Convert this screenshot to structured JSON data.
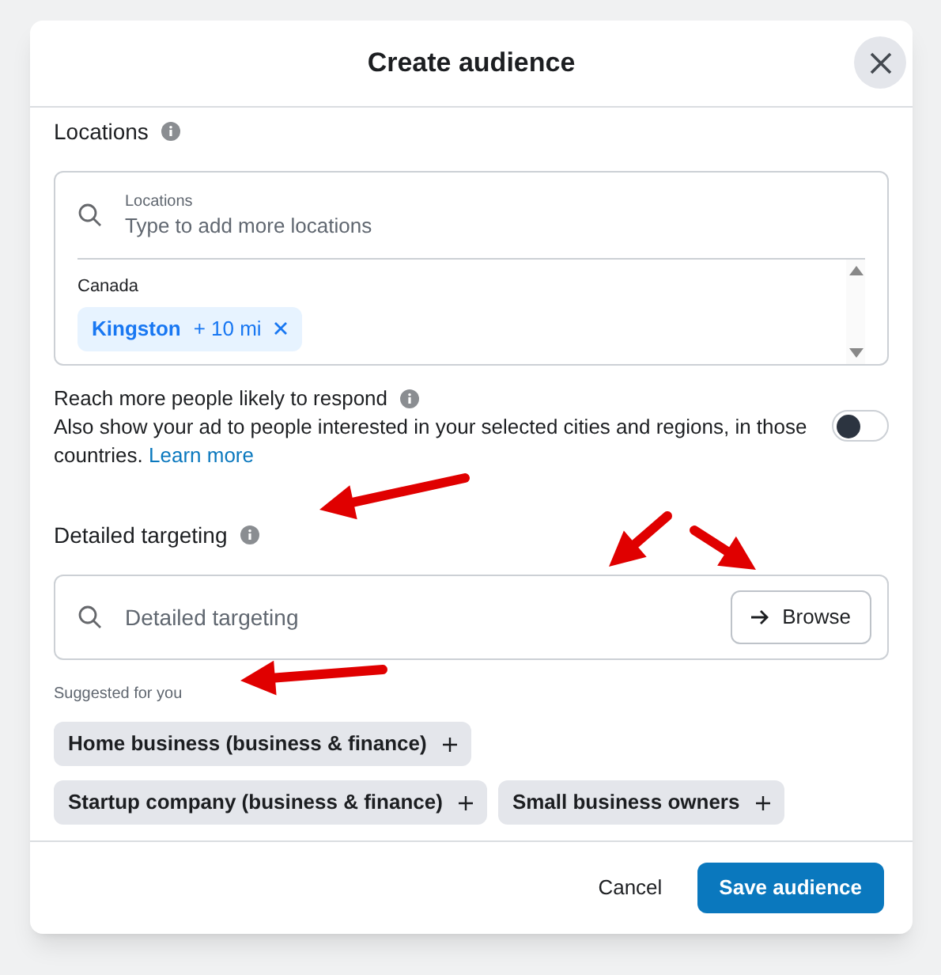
{
  "dialog": {
    "title": "Create audience"
  },
  "locations": {
    "label": "Locations",
    "field_label": "Locations",
    "placeholder": "Type to add more locations",
    "country": "Canada",
    "chips": [
      {
        "name": "Kingston",
        "radius": "+ 10 mi"
      }
    ]
  },
  "reach_more": {
    "title": "Reach more people likely to respond",
    "description": "Also show your ad to people interested in your selected cities and regions, in those countries.",
    "link": "Learn more",
    "on": false
  },
  "detailed_targeting": {
    "label": "Detailed targeting",
    "placeholder": "Detailed targeting",
    "browse": "Browse"
  },
  "suggestions": {
    "label": "Suggested for you",
    "rows": [
      [
        "Home business (business & finance)"
      ],
      [
        "Startup company (business & finance)",
        "Small business owners"
      ]
    ]
  },
  "footer": {
    "cancel": "Cancel",
    "save": "Save audience"
  }
}
